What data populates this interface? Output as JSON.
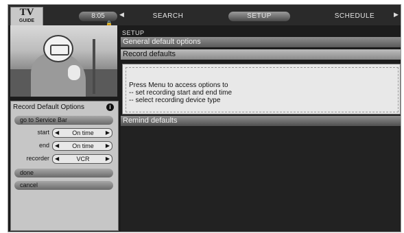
{
  "logo": {
    "top": "TV",
    "bottom": "GUIDE"
  },
  "topbar": {
    "time": "8:05",
    "tabs": {
      "search": "SEARCH",
      "setup": "SETUP",
      "schedule": "SCHEDULE"
    }
  },
  "left_panel": {
    "title": "Record Default Options",
    "service_bar_button": "go to Service Bar",
    "fields": {
      "start": {
        "label": "start",
        "value": "On time"
      },
      "end": {
        "label": "end",
        "value": "On time"
      },
      "recorder": {
        "label": "recorder",
        "value": "VCR"
      }
    },
    "done_button": "done",
    "cancel_button": "cancel"
  },
  "main": {
    "breadcrumb": "SETUP",
    "sections": {
      "general": "General default options",
      "record": "Record defaults",
      "remind": "Remind defaults"
    },
    "content_lines": [
      "Press Menu to access options to",
      "-- set recording start and end time",
      "-- select recording device type"
    ]
  },
  "icons": {
    "info": "info-icon",
    "lock": "lock-icon",
    "arrow_left": "left-arrow-icon",
    "arrow_right": "right-arrow-icon"
  },
  "colors": {
    "screen_bg": "#1c1c1c",
    "panel_bg": "#c6c6c6"
  }
}
